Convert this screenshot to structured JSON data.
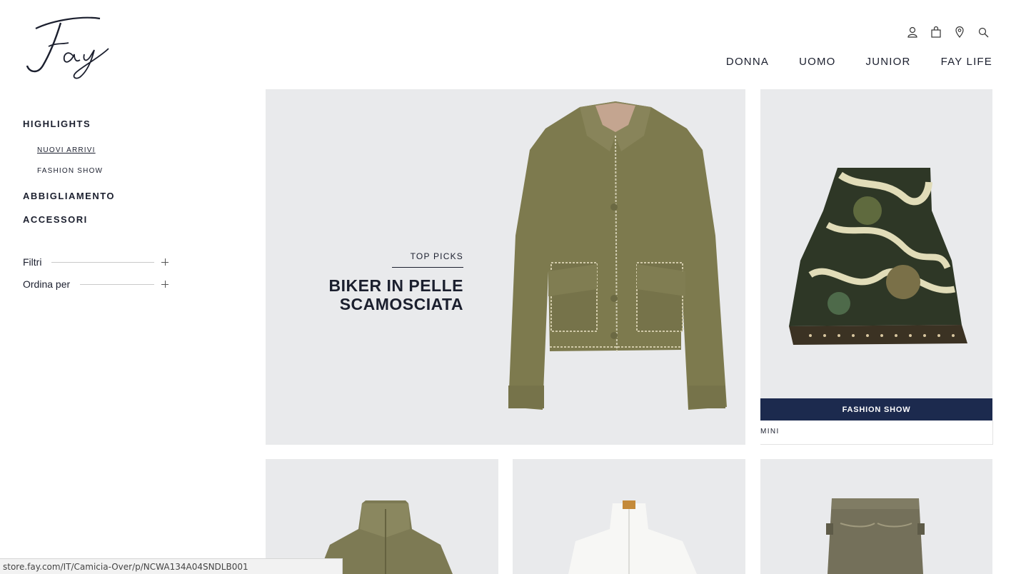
{
  "brand": {
    "logo_text": "Fay"
  },
  "header": {
    "icons": [
      "user-icon",
      "bag-icon",
      "location-icon",
      "search-icon"
    ],
    "nav": [
      "DONNA",
      "UOMO",
      "JUNIOR",
      "FAY LIFE"
    ]
  },
  "sidebar": {
    "highlights": "HIGHLIGHTS",
    "highlights_items": [
      "NUOVI ARRIVI",
      "FASHION SHOW"
    ],
    "abbigliamento": "ABBIGLIAMENTO",
    "accessori": "ACCESSORI",
    "filters_label": "Filtri",
    "sort_label": "Ordina per"
  },
  "hero": {
    "kicker": "TOP PICKS",
    "title": "BIKER IN PELLE\nSCAMOSCIATA"
  },
  "product": {
    "badge": "FASHION SHOW",
    "name": "MINI"
  },
  "status_bar": {
    "url": "store.fay.com/IT/Camicia-Over/p/NCWA134A04SNDLB001"
  },
  "colors": {
    "navy": "#1c2a4e",
    "tile_bg": "#e9eaec",
    "text": "#1b1f2e"
  }
}
